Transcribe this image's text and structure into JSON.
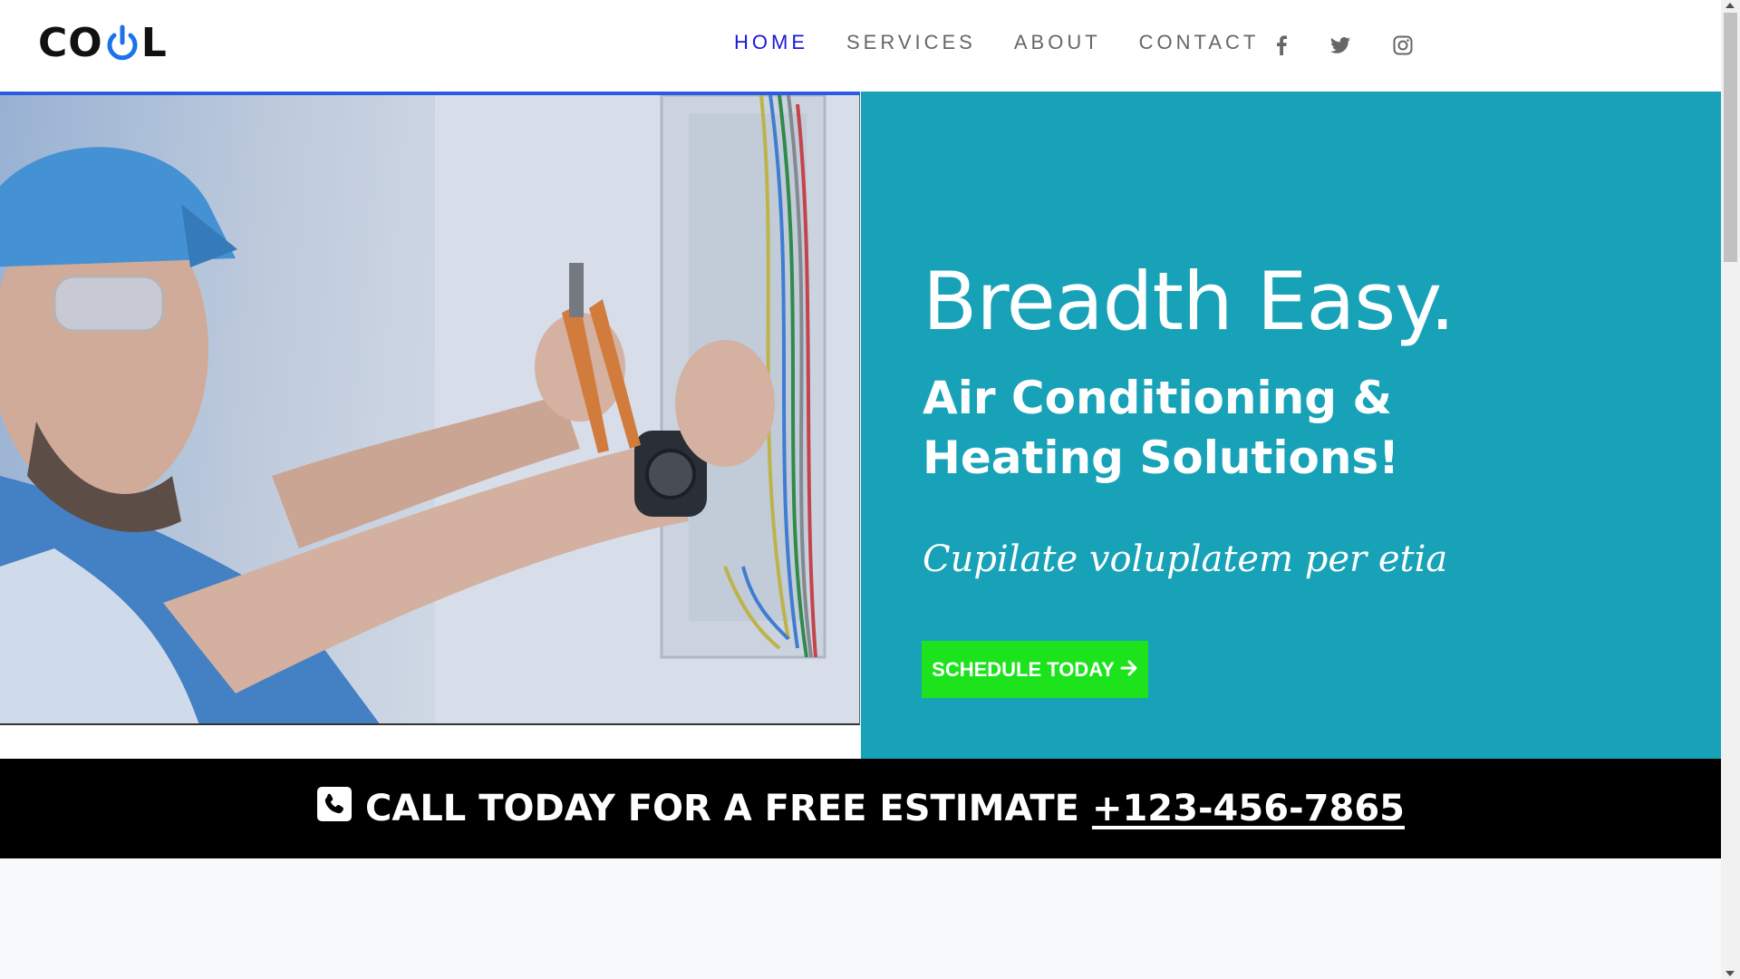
{
  "brand": {
    "logo_left": "CO",
    "logo_right": "L",
    "accent": "#1a73e8"
  },
  "nav": {
    "items": [
      {
        "label": "HOME",
        "active": true
      },
      {
        "label": "SERVICES",
        "active": false
      },
      {
        "label": "ABOUT",
        "active": false
      },
      {
        "label": "CONTACT",
        "active": false
      }
    ],
    "social_icons": [
      "facebook-icon",
      "twitter-icon",
      "instagram-icon"
    ],
    "active_color": "#1a1ad6",
    "inactive_color": "#666666"
  },
  "hero": {
    "headline": "Breadth Easy.",
    "subheadline": "Air Conditioning & Heating Solutions!",
    "tagline": "Cupilate voluplatem per etia",
    "cta_label": "SCHEDULE TODAY",
    "cta_icon": "arrow-right-icon",
    "panel_color": "#18a2b8",
    "cta_color": "#1de31d",
    "image": "technician-wiring-photo"
  },
  "callbar": {
    "icon": "phone-icon",
    "text": "CALL TODAY FOR A FREE ESTIMATE",
    "phone": "+123-456-7865"
  }
}
